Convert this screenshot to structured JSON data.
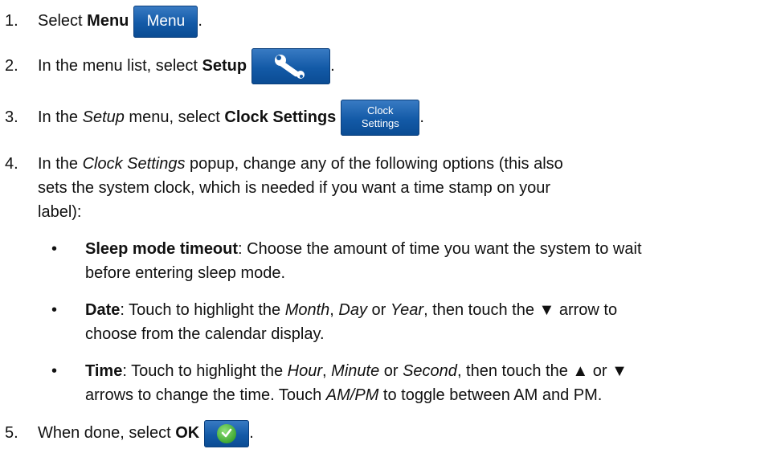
{
  "steps": [
    {
      "num": "1.",
      "pre": "Select ",
      "bold": "Menu",
      "post": ".",
      "button": "Menu"
    },
    {
      "num": "2.",
      "pre": "In the menu list, select ",
      "bold": "Setup",
      "post": ".",
      "button_icon": "wrench-icon"
    },
    {
      "num": "3.",
      "pre": "In the ",
      "italic": "Setup",
      "mid": " menu, select ",
      "bold": "Clock Settings",
      "post": ".",
      "button_line1": "Clock",
      "button_line2": "Settings"
    },
    {
      "num": "4.",
      "line1_pre": "In the ",
      "line1_italic": "Clock Settings",
      "line1_post": " popup, change any of the following options (this also",
      "line2": "sets the system clock, which is needed if you want a time stamp on your",
      "line3": "label):"
    },
    {
      "num": "5.",
      "pre": "When done, select ",
      "bold": "OK",
      "post": ".",
      "button_icon": "checkmark-icon"
    }
  ],
  "bullets": [
    {
      "symbol": "•",
      "bold": "Sleep mode timeout",
      "line1_rest": ": Choose the amount of time you want the system to wait",
      "line2": "before entering sleep mode."
    },
    {
      "symbol": "•",
      "bold": "Date",
      "t1": ": Touch to highlight the ",
      "i1": "Month",
      "t2": ", ",
      "i2": "Day",
      "t3": " or ",
      "i3": "Year",
      "t4": ", then touch the ▼ arrow to",
      "line2": "choose from the calendar display."
    },
    {
      "symbol": "•",
      "bold": "Time",
      "t1": ": Touch to highlight the ",
      "i1": "Hour",
      "t2": ", ",
      "i2": "Minute",
      "t3": " or ",
      "i3": "Second",
      "t4": ", then touch the ▲ or ▼",
      "line2_pre": "arrows to change the time. Touch ",
      "line2_italic": "AM/PM",
      "line2_post": " to toggle between AM and PM."
    }
  ],
  "colors": {
    "button_blue": "#135aa7",
    "ok_green": "#3fa832"
  }
}
